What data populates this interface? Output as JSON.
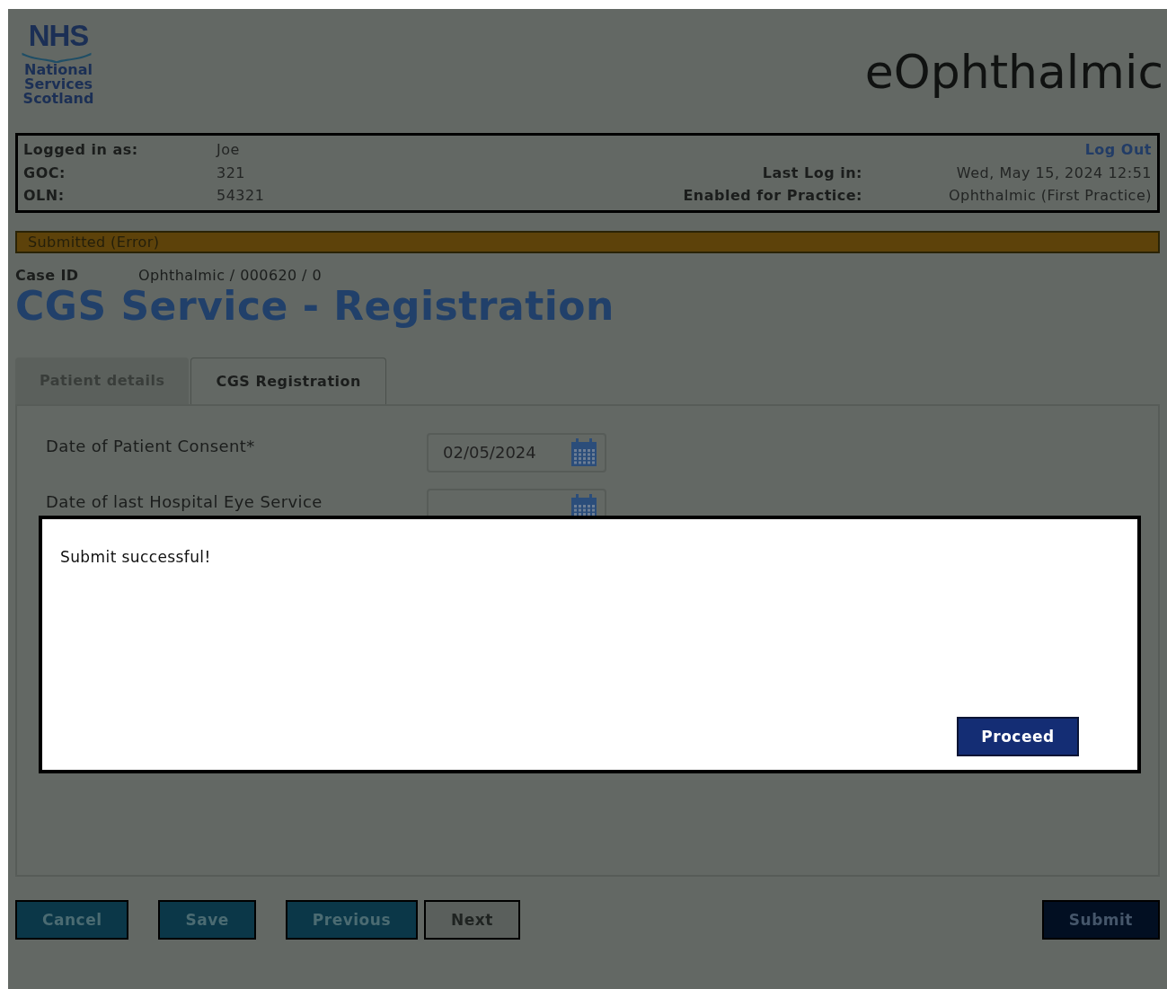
{
  "header": {
    "logo": {
      "mark": "NHS",
      "lines": [
        "National",
        "Services",
        "Scotland"
      ]
    },
    "app_title": "eOphthalmic"
  },
  "user_panel": {
    "left": [
      {
        "label": "Logged in as:",
        "value": "Joe"
      },
      {
        "label": "GOC:",
        "value": "321"
      },
      {
        "label": "OLN:",
        "value": "54321"
      }
    ],
    "logout": "Log Out",
    "right": [
      {
        "label": "Last Log in:",
        "value": "Wed, May 15, 2024 12:51"
      },
      {
        "label": "Enabled for Practice:",
        "value": "Ophthalmic (First Practice)"
      }
    ]
  },
  "status_banner": "Submitted (Error)",
  "case": {
    "label": "Case ID",
    "value": "Ophthalmic / 000620 / 0"
  },
  "page_title": "CGS Service - Registration",
  "tabs": [
    {
      "label": "Patient details",
      "selected": false
    },
    {
      "label": "CGS Registration",
      "selected": true
    }
  ],
  "fields": [
    {
      "label": "Date of Patient Consent*",
      "value": "02/05/2024"
    },
    {
      "label": "Date of last Hospital Eye Service"
    }
  ],
  "dialog": {
    "message": "Submit successful!",
    "button": "Proceed"
  },
  "buttons": [
    {
      "label": "Cancel",
      "disabled": false,
      "kind": "secondary"
    },
    {
      "label": "Save",
      "disabled": false,
      "kind": "secondary"
    },
    {
      "label": "Previous",
      "disabled": false,
      "kind": "secondary"
    },
    {
      "label": "Next",
      "disabled": true,
      "kind": "secondary"
    },
    {
      "label": "Submit",
      "disabled": false,
      "kind": "primary"
    }
  ]
}
